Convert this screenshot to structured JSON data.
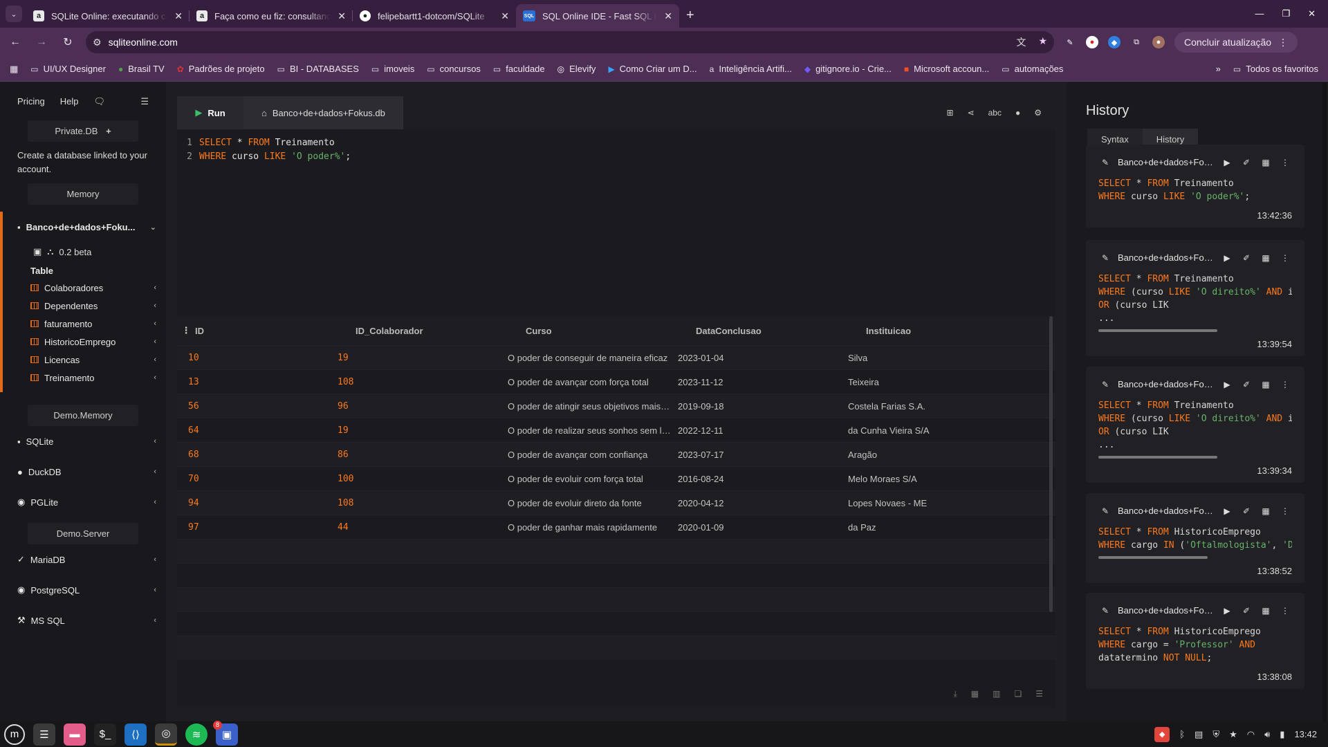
{
  "browser": {
    "tabs": [
      {
        "title": "SQLite Online: executando consultas",
        "favicon": "a",
        "active": false
      },
      {
        "title": "Faça como eu fiz: consultando",
        "favicon": "a",
        "active": false
      },
      {
        "title": "felipebartt1-dotcom/SQLite",
        "favicon": "github",
        "active": false
      },
      {
        "title": "SQL Online IDE - Fast SQL Editor",
        "favicon": "SQL",
        "active": true
      }
    ],
    "url": "sqliteonline.com",
    "update_button": "Concluir atualização",
    "bookmarks": [
      {
        "label": "UI/UX Designer",
        "icon": "folder-icon"
      },
      {
        "label": "Brasil TV",
        "icon": "tv-icon"
      },
      {
        "label": "Padrões de projeto",
        "icon": "site-icon"
      },
      {
        "label": "BI - DATABASES",
        "icon": "folder-icon"
      },
      {
        "label": "imoveis",
        "icon": "folder-icon"
      },
      {
        "label": "concursos",
        "icon": "folder-icon"
      },
      {
        "label": "faculdade",
        "icon": "folder-icon"
      },
      {
        "label": "Elevify",
        "icon": "site-icon"
      },
      {
        "label": "Como Criar um D...",
        "icon": "video-icon"
      },
      {
        "label": "Inteligência Artifi...",
        "icon": "site-icon"
      },
      {
        "label": "gitignore.io - Crie...",
        "icon": "site-icon"
      },
      {
        "label": "Microsoft accoun...",
        "icon": "microsoft-icon"
      },
      {
        "label": "automações",
        "icon": "folder-icon"
      }
    ],
    "all_favorites": "Todos os favoritos"
  },
  "sidebar": {
    "top_links": [
      "Pricing",
      "Help"
    ],
    "private_db": "Private.DB",
    "create_text": "Create a database linked to your account.",
    "memory_label": "Memory",
    "db_name": "Banco+de+dados+Foku...",
    "version": "0.2 beta",
    "table_header": "Table",
    "tables": [
      "Colaboradores",
      "Dependentes",
      "faturamento",
      "HistoricoEmprego",
      "Licencas",
      "Treinamento"
    ],
    "demo_memory_label": "Demo.Memory",
    "demo_memory": [
      "SQLite",
      "DuckDB",
      "PGLite"
    ],
    "demo_server_label": "Demo.Server",
    "demo_server": [
      "MariaDB",
      "PostgreSQL",
      "MS SQL"
    ]
  },
  "editor": {
    "run_label": "Run",
    "file_tab": "Banco+de+dados+Fokus.db",
    "line_numbers": [
      "1",
      "2"
    ]
  },
  "results": {
    "columns": [
      "ID",
      "ID_Colaborador",
      "Curso",
      "DataConclusao",
      "Instituicao"
    ],
    "rows": [
      [
        "10",
        "19",
        "O poder de conseguir de maneira eficaz",
        "2023-01-04",
        "Silva"
      ],
      [
        "13",
        "108",
        "O poder de avançar com força total",
        "2023-11-12",
        "Teixeira"
      ],
      [
        "56",
        "96",
        "O poder de atingir seus objetivos mais rapidamente",
        "2019-09-18",
        "Costela Farias S.A."
      ],
      [
        "64",
        "19",
        "O poder de realizar seus sonhos sem limites",
        "2022-12-11",
        "da Cunha Vieira S/A"
      ],
      [
        "68",
        "86",
        "O poder de avançar com confiança",
        "2023-07-17",
        "Aragão"
      ],
      [
        "70",
        "100",
        "O poder de evoluir com força total",
        "2016-08-24",
        "Melo Moraes S/A"
      ],
      [
        "94",
        "108",
        "O poder de evoluir direto da fonte",
        "2020-04-12",
        "Lopes Novaes - ME"
      ],
      [
        "97",
        "44",
        "O poder de ganhar mais rapidamente",
        "2020-01-09",
        "da Paz"
      ]
    ]
  },
  "history": {
    "title": "History",
    "tabs": [
      "Syntax",
      "History"
    ],
    "items": [
      {
        "name": "Banco+de+dados+Foku...",
        "time": "13:42:36"
      },
      {
        "name": "Banco+de+dados+Foku...",
        "time": "13:39:54"
      },
      {
        "name": "Banco+de+dados+Foku...",
        "time": "13:39:34"
      },
      {
        "name": "Banco+de+dados+Foku...",
        "time": "13:38:52"
      },
      {
        "name": "Banco+de+dados+Foku...",
        "time": "13:38:08"
      }
    ]
  },
  "taskbar": {
    "clock": "13:42",
    "badge": "8"
  },
  "colors": {
    "accent": "#ff7a1a",
    "run": "#3cbf6a",
    "chrome_tab": "#4d2f55"
  }
}
